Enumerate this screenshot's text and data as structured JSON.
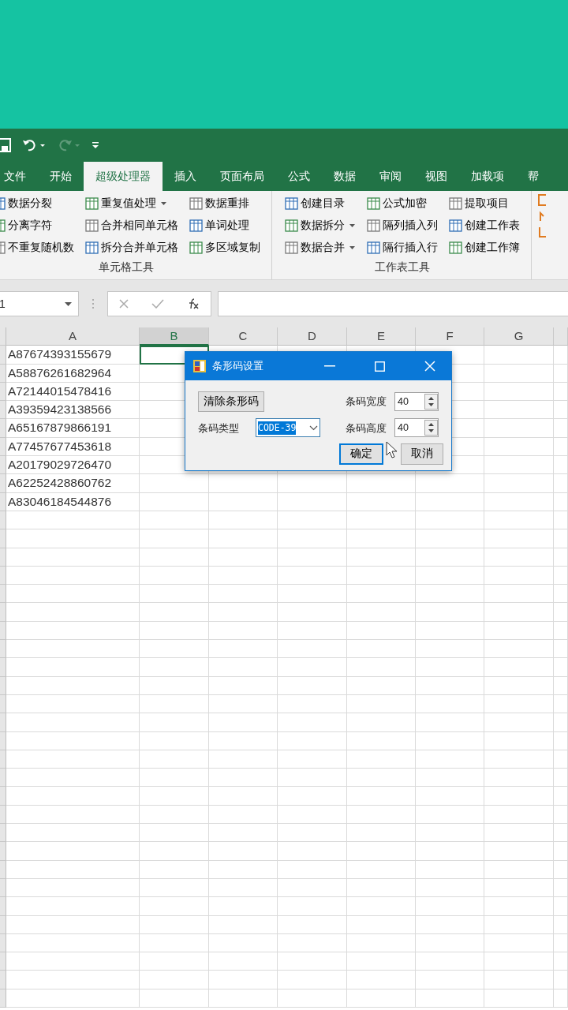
{
  "tabs": [
    {
      "label": "文件",
      "selected": false
    },
    {
      "label": "开始",
      "selected": false
    },
    {
      "label": "超级处理器",
      "selected": true
    },
    {
      "label": "插入",
      "selected": false
    },
    {
      "label": "页面布局",
      "selected": false
    },
    {
      "label": "公式",
      "selected": false
    },
    {
      "label": "数据",
      "selected": false
    },
    {
      "label": "审阅",
      "selected": false
    },
    {
      "label": "视图",
      "selected": false
    },
    {
      "label": "加载项",
      "selected": false
    },
    {
      "label": "帮",
      "selected": false
    }
  ],
  "ribbon_groups": [
    {
      "label": "单元格工具",
      "columns": [
        [
          {
            "label": "数据分裂",
            "dropdown": false
          },
          {
            "label": "分离字符",
            "dropdown": false
          },
          {
            "label": "不重复随机数",
            "dropdown": false
          }
        ],
        [
          {
            "label": "重复值处理",
            "dropdown": true
          },
          {
            "label": "合并相同单元格",
            "dropdown": false
          },
          {
            "label": "拆分合并单元格",
            "dropdown": false
          }
        ],
        [
          {
            "label": "数据重排",
            "dropdown": false
          },
          {
            "label": "单词处理",
            "dropdown": false
          },
          {
            "label": "多区域复制",
            "dropdown": false
          }
        ]
      ]
    },
    {
      "label": "工作表工具",
      "columns": [
        [
          {
            "label": "创建目录",
            "dropdown": false
          },
          {
            "label": "数据拆分",
            "dropdown": true
          },
          {
            "label": "数据合并",
            "dropdown": true
          }
        ],
        [
          {
            "label": "公式加密",
            "dropdown": false
          },
          {
            "label": "隔列插入列",
            "dropdown": false
          },
          {
            "label": "隔行插入行",
            "dropdown": false
          }
        ],
        [
          {
            "label": "提取项目",
            "dropdown": false
          },
          {
            "label": "创建工作表",
            "dropdown": false
          },
          {
            "label": "创建工作簿",
            "dropdown": false
          }
        ]
      ]
    }
  ],
  "formula_bar": {
    "name_box": "1"
  },
  "sheet": {
    "columns": [
      {
        "label": "A",
        "selected": false
      },
      {
        "label": "B",
        "selected": true
      },
      {
        "label": "C",
        "selected": false
      },
      {
        "label": "D",
        "selected": false
      },
      {
        "label": "E",
        "selected": false
      },
      {
        "label": "F",
        "selected": false
      },
      {
        "label": "G",
        "selected": false
      }
    ],
    "rows": [
      {
        "cells": [
          {
            "text": "A87674393155679",
            "selected": false
          },
          {
            "selected": true
          }
        ]
      },
      {
        "cells": [
          {
            "text": "A58876261682964",
            "selected": false
          }
        ]
      },
      {
        "cells": [
          {
            "text": "A72144015478416",
            "selected": false
          }
        ]
      },
      {
        "cells": [
          {
            "text": "A39359423138566",
            "selected": false
          }
        ]
      },
      {
        "cells": [
          {
            "text": "A65167879866191",
            "selected": false
          }
        ]
      },
      {
        "cells": [
          {
            "text": "A77457677453618",
            "selected": false
          }
        ]
      },
      {
        "cells": [
          {
            "text": "A20179029726470",
            "selected": false
          }
        ]
      },
      {
        "cells": [
          {
            "text": "A62252428860762",
            "selected": false
          }
        ]
      },
      {
        "cells": [
          {
            "text": "A83046184544876",
            "selected": false
          }
        ]
      }
    ]
  },
  "dialog": {
    "title": "条形码设置",
    "clear_button": "清除条形码",
    "type_label": "条码类型",
    "type_value": "CODE-39",
    "width_label": "条码宽度",
    "width_value": "40",
    "height_label": "条码高度",
    "height_value": "40",
    "ok_button": "确定",
    "cancel_button": "取消"
  }
}
